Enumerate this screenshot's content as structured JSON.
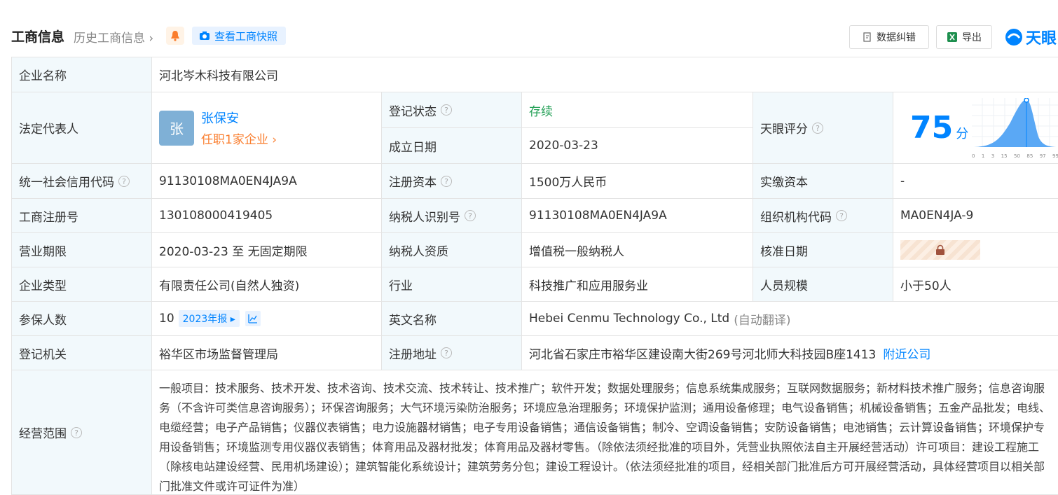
{
  "header": {
    "title": "工商信息",
    "history": "历史工商信息",
    "snapshot": "查看工商快照",
    "data_correction": "数据纠错",
    "export": "导出",
    "brand": "天眼"
  },
  "rows": {
    "company_name_label": "企业名称",
    "company_name": "河北岑木科技有限公司",
    "legal_rep_label": "法定代表人",
    "legal_rep_avatar": "张",
    "legal_rep_name": "张保安",
    "legal_rep_positions": "任职1家企业",
    "status_label": "登记状态",
    "status": "存续",
    "founded_label": "成立日期",
    "founded": "2020-03-23",
    "score_label": "天眼评分",
    "score": "75",
    "score_unit": "分",
    "score_ticks": [
      "0",
      "1",
      "3",
      "15",
      "50",
      "85",
      "97",
      "99"
    ],
    "credit_code_label": "统一社会信用代码",
    "credit_code": "91130108MA0EN4JA9A",
    "reg_capital_label": "注册资本",
    "reg_capital": "1500万人民币",
    "paid_capital_label": "实缴资本",
    "paid_capital": "-",
    "reg_no_label": "工商注册号",
    "reg_no": "130108000419405",
    "taxpayer_id_label": "纳税人识别号",
    "taxpayer_id": "91130108MA0EN4JA9A",
    "org_code_label": "组织机构代码",
    "org_code": "MA0EN4JA-9",
    "term_label": "营业期限",
    "term": "2020-03-23 至 无固定期限",
    "taxpayer_qual_label": "纳税人资质",
    "taxpayer_qual": "增值税一般纳税人",
    "approval_label": "核准日期",
    "type_label": "企业类型",
    "type": "有限责任公司(自然人独资)",
    "industry_label": "行业",
    "industry": "科技推广和应用服务业",
    "staff_label": "人员规模",
    "staff": "小于50人",
    "insured_label": "参保人数",
    "insured": "10",
    "insured_tag": "2023年报",
    "english_label": "英文名称",
    "english": "Hebei Cenmu Technology Co., Ltd",
    "english_note": "(自动翻译)",
    "authority_label": "登记机关",
    "authority": "裕华区市场监督管理局",
    "address_label": "注册地址",
    "address": "河北省石家庄市裕华区建设南大街269号河北师大科技园B座1413",
    "nearby": "附近公司",
    "scope_label": "经营范围",
    "scope": "一般项目：技术服务、技术开发、技术咨询、技术交流、技术转让、技术推广；软件开发；数据处理服务；信息系统集成服务；互联网数据服务；新材料技术推广服务；信息咨询服务（不含许可类信息咨询服务）；环保咨询服务；大气环境污染防治服务；环境应急治理服务；环境保护监测；通用设备修理；电气设备销售；机械设备销售；五金产品批发；电线、电缆经营；电子产品销售；仪器仪表销售；电力设施器材销售；电子专用设备销售；通信设备销售；制冷、空调设备销售；安防设备销售；电池销售；云计算设备销售；环境保护专用设备销售；环境监测专用仪器仪表销售；体育用品及器材批发；体育用品及器材零售。（除依法须经批准的项目外，凭营业执照依法自主开展经营活动）许可项目：建设工程施工（除核电站建设经营、民用机场建设）；建筑智能化系统设计；建筑劳务分包；建设工程设计。（依法须经批准的项目，经相关部门批准后方可开展经营活动，具体经营项目以相关部门批准文件或许可证件为准）"
  },
  "colors": {
    "accent": "#0084ff",
    "label_bg": "#f2f9fc",
    "status": "#23a056",
    "link_orange": "#fa7d2d"
  }
}
